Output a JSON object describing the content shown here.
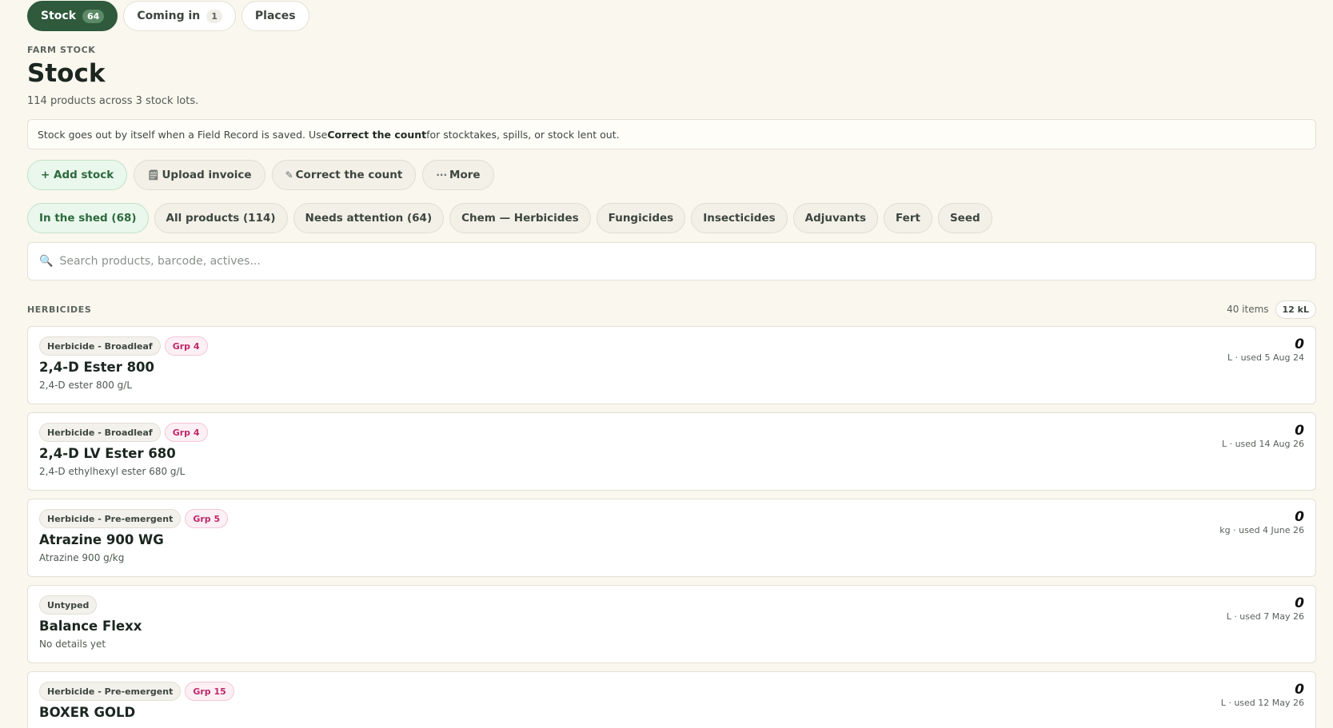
{
  "top_tabs": [
    {
      "label": "Stock",
      "count": "64"
    },
    {
      "label": "Coming in",
      "count": "1"
    },
    {
      "label": "Places",
      "count": null
    }
  ],
  "header": {
    "eyebrow": "FARM STOCK",
    "title": "Stock",
    "subtitle": "114 products across 3 stock lots."
  },
  "notice": {
    "before": "Stock goes out by itself when a Field Record is saved. Use ",
    "bold": "Correct the count",
    "after": " for stocktakes, spills, or stock lent out."
  },
  "actions": {
    "add": "+ Add stock",
    "upload": "Upload invoice",
    "correct": "Correct the count",
    "more": "More"
  },
  "filters": [
    "In the shed (68)",
    "All products (114)",
    "Needs attention (64)",
    "Chem — Herbicides",
    "Fungicides",
    "Insecticides",
    "Adjuvants",
    "Fert",
    "Seed"
  ],
  "search": {
    "placeholder": "Search products, barcode, actives..."
  },
  "section": {
    "label": "HERBICIDES",
    "items": "40 items",
    "volume": "12 kL"
  },
  "products": [
    {
      "type": "Herbicide - Broadleaf",
      "group": "Grp 4",
      "name": "2,4-D Ester 800",
      "desc": "2,4-D ester 800 g/L",
      "qty": "0",
      "meta": "L · used 5 Aug 24"
    },
    {
      "type": "Herbicide - Broadleaf",
      "group": "Grp 4",
      "name": "2,4-D LV Ester 680",
      "desc": "2,4-D ethylhexyl ester 680 g/L",
      "qty": "0",
      "meta": "L · used 14 Aug 26"
    },
    {
      "type": "Herbicide - Pre-emergent",
      "group": "Grp 5",
      "name": "Atrazine 900 WG",
      "desc": "Atrazine 900 g/kg",
      "qty": "0",
      "meta": "kg · used 4 June 26"
    },
    {
      "type": "Untyped",
      "group": null,
      "name": "Balance Flexx",
      "desc": "No details yet",
      "qty": "0",
      "meta": "L · used 7 May 26"
    },
    {
      "type": "Herbicide - Pre-emergent",
      "group": "Grp 15",
      "name": "BOXER GOLD",
      "desc": "",
      "qty": "0",
      "meta": "L · used 12 May 26"
    }
  ]
}
